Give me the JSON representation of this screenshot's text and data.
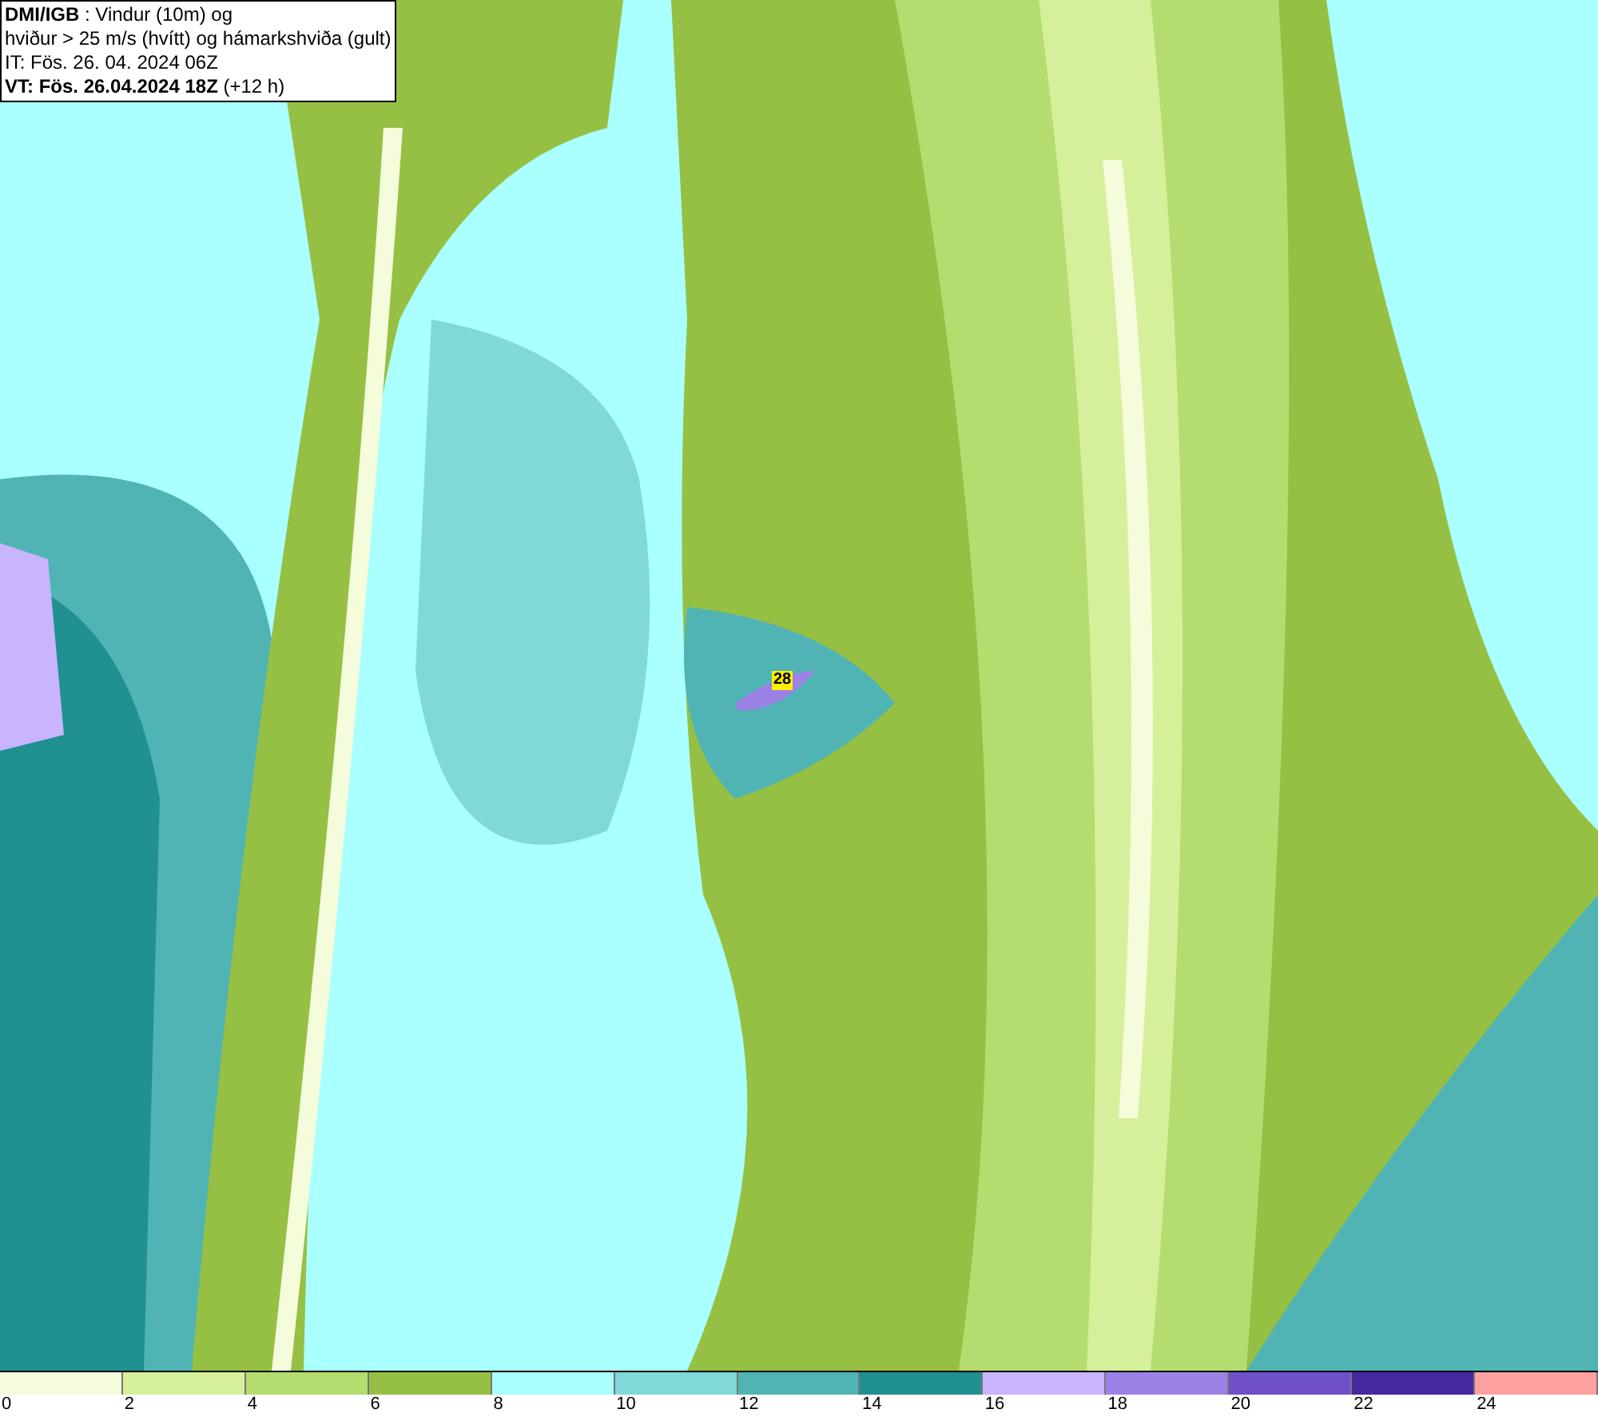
{
  "header": {
    "lines": [
      "**DMI/IGB** : Vindur (10m) og",
      "hviður > 25 m/s (hvítt) og hámarkshviða (gult)",
      "IT: Fös. 26. 04. 2024 06Z",
      "**VT: Fös. 26.04.2024 18Z** (+12 h)"
    ]
  },
  "map": {
    "max_gust_label": "28"
  },
  "legend": [
    {
      "label": "0",
      "color": "#f5fcdc"
    },
    {
      "label": "2",
      "color": "#d6ef9a"
    },
    {
      "label": "4",
      "color": "#b4dc6e"
    },
    {
      "label": "6",
      "color": "#96c044"
    },
    {
      "label": "8",
      "color": "#aaffff"
    },
    {
      "label": "10",
      "color": "#80d8d8"
    },
    {
      "label": "12",
      "color": "#50b4b4"
    },
    {
      "label": "14",
      "color": "#209090"
    },
    {
      "label": "16",
      "color": "#c8b4ff"
    },
    {
      "label": "18",
      "color": "#9c82e6"
    },
    {
      "label": "20",
      "color": "#7050c8"
    },
    {
      "label": "22",
      "color": "#4628a0"
    },
    {
      "label": "24",
      "color": "#ffa0a0"
    }
  ]
}
